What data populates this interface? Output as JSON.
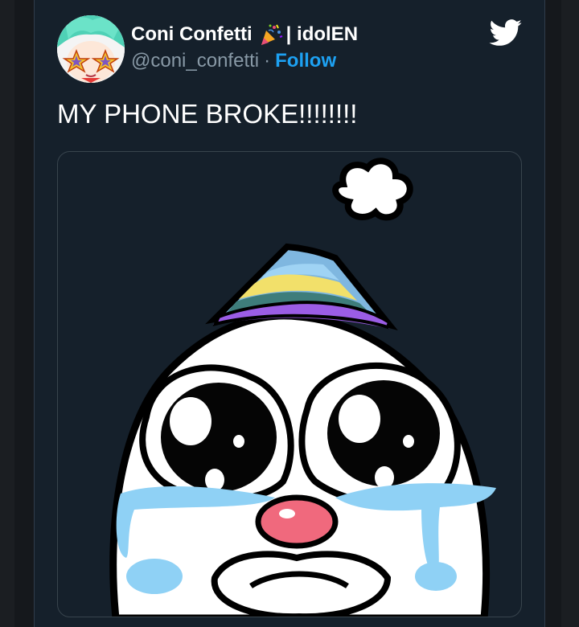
{
  "tweet": {
    "display_name": "Coni Confetti",
    "name_suffix": "| idolEN",
    "handle": "@coni_confetti",
    "separator": "·",
    "follow_label": "Follow",
    "text": "MY PHONE BROKE!!!!!!!!",
    "media": {
      "description_icon": "crying-clown-drawing"
    },
    "icons": {
      "brand": "twitter-bird-icon",
      "name_emoji": "party-popper-icon"
    }
  },
  "colors": {
    "background": "#15202b",
    "follow": "#1da1f2",
    "handle": "#8899a6",
    "text": "#ffffff",
    "twitter_blue": "#1da1f2"
  }
}
